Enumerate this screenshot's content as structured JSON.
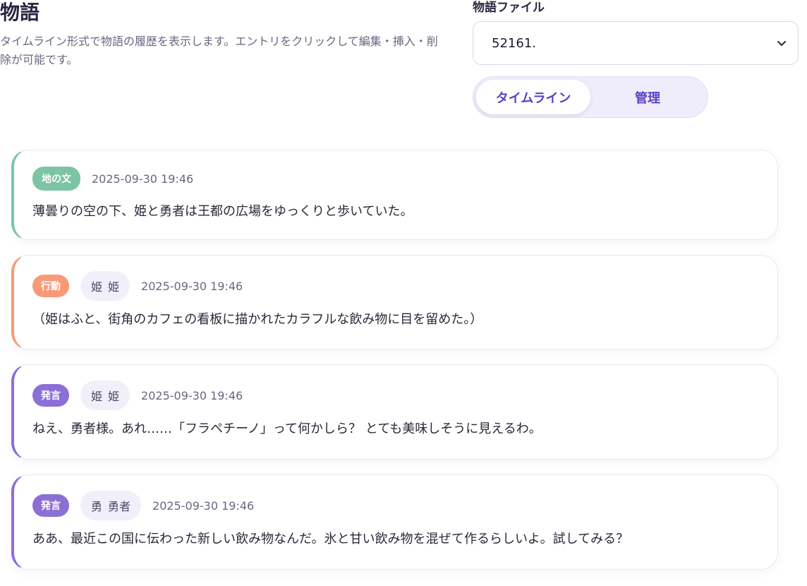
{
  "header": {
    "title": "物語",
    "description": "タイムライン形式で物語の履歴を表示します。エントリをクリックして編集・挿入・削除が可能です。"
  },
  "file_picker": {
    "label": "物語ファイル",
    "selected": "52161."
  },
  "view_toggle": {
    "timeline_label": "タイムライン",
    "manage_label": "管理",
    "active": "timeline"
  },
  "colors": {
    "narration": "#7cc4a4",
    "action": "#f79a78",
    "speech": "#8b6fd6",
    "accent": "#5b3fc4"
  },
  "entries": [
    {
      "type_label": "地の文",
      "type": "narration",
      "speaker_initial": "",
      "speaker_name": "",
      "timestamp": "2025-09-30 19:46",
      "text": "薄曇りの空の下、姫と勇者は王都の広場をゆっくりと歩いていた。"
    },
    {
      "type_label": "行動",
      "type": "action",
      "speaker_initial": "姫",
      "speaker_name": "姫",
      "timestamp": "2025-09-30 19:46",
      "text": "（姫はふと、街角のカフェの看板に描かれたカラフルな飲み物に目を留めた。）"
    },
    {
      "type_label": "発言",
      "type": "speech",
      "speaker_initial": "姫",
      "speaker_name": "姫",
      "timestamp": "2025-09-30 19:46",
      "text": "ねえ、勇者様。あれ……「フラペチーノ」って何かしら？ とても美味しそうに見えるわ。"
    },
    {
      "type_label": "発言",
      "type": "speech",
      "speaker_initial": "勇",
      "speaker_name": "勇者",
      "timestamp": "2025-09-30 19:46",
      "text": "ああ、最近この国に伝わった新しい飲み物なんだ。氷と甘い飲み物を混ぜて作るらしいよ。試してみる？"
    }
  ]
}
